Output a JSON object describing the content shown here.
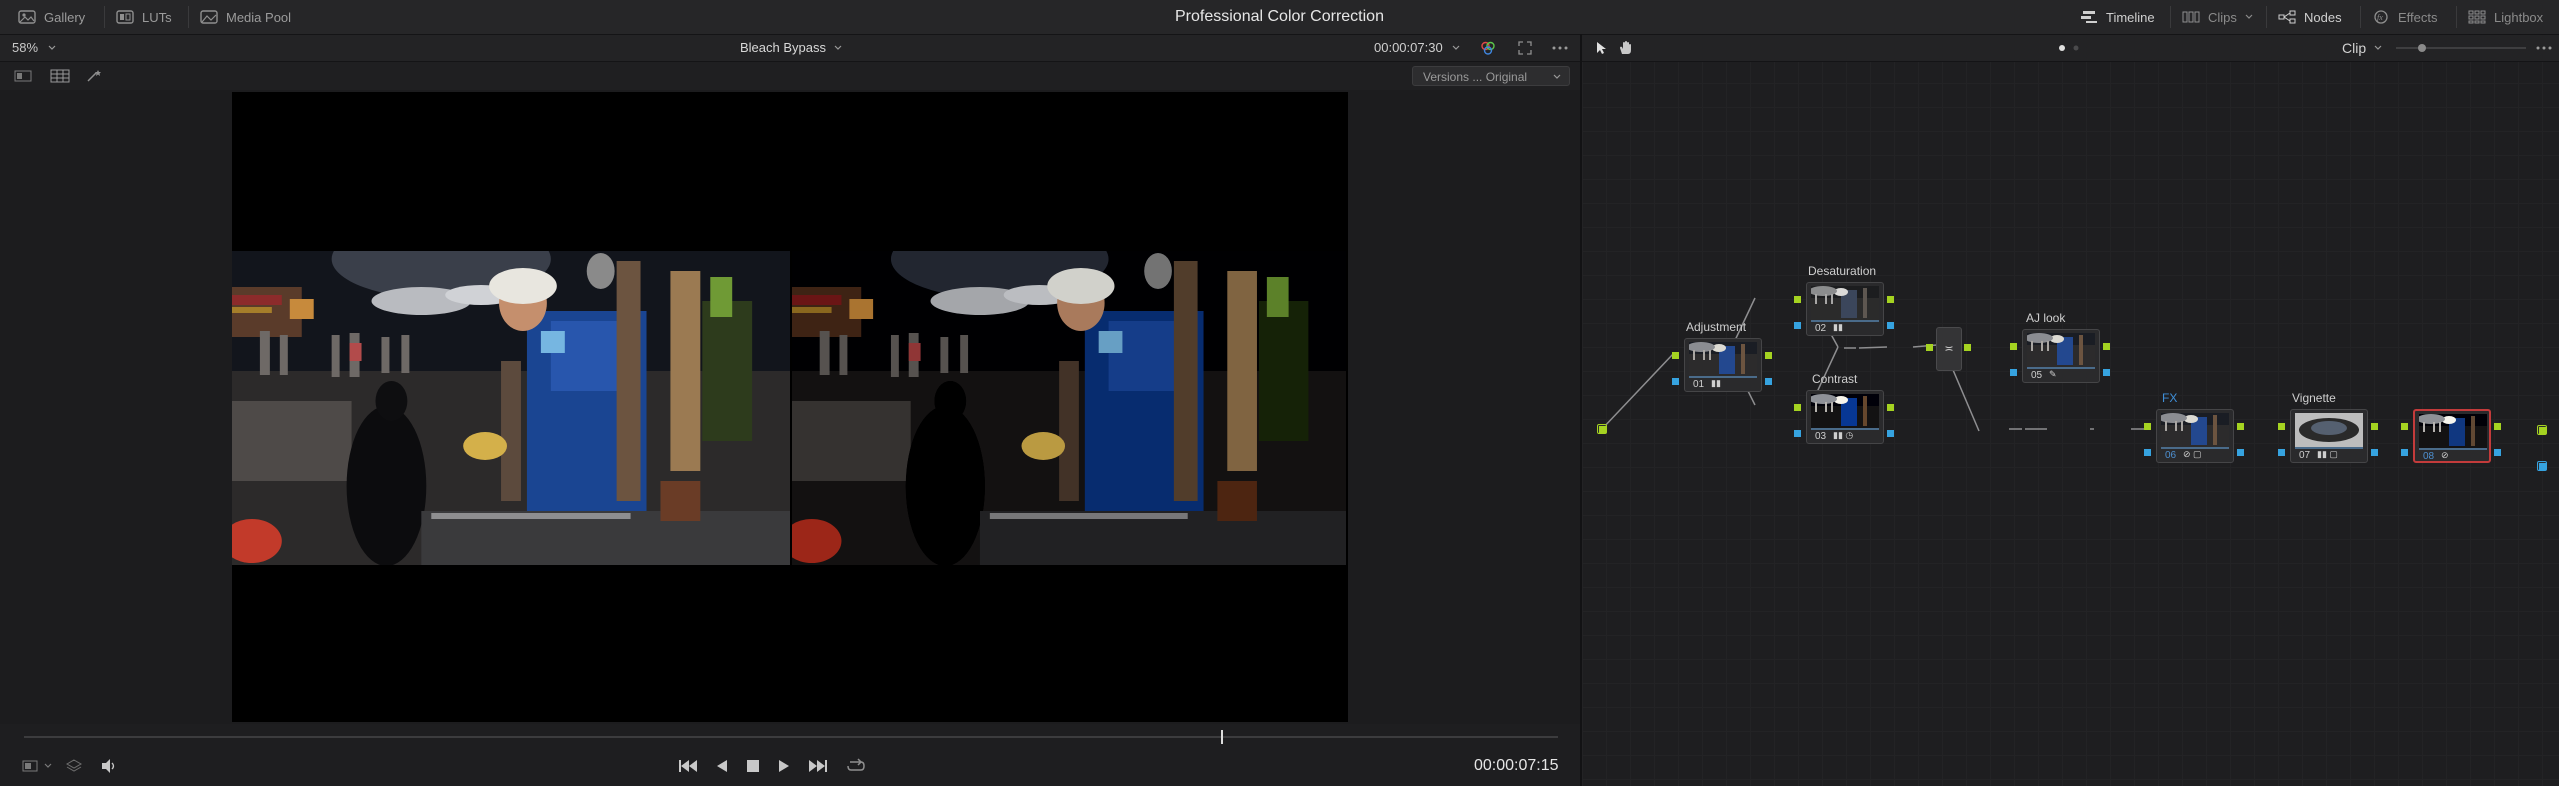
{
  "app": {
    "title": "Professional Color Correction"
  },
  "topbar": {
    "left": [
      {
        "label": "Gallery",
        "icon": "gallery-icon"
      },
      {
        "label": "LUTs",
        "icon": "luts-icon"
      },
      {
        "label": "Media Pool",
        "icon": "media-pool-icon"
      }
    ],
    "right": [
      {
        "label": "Timeline",
        "icon": "timeline-icon"
      },
      {
        "label": "Clips",
        "icon": "clips-icon"
      },
      {
        "label": "Nodes",
        "icon": "nodes-icon"
      },
      {
        "label": "Effects",
        "icon": "effects-icon"
      },
      {
        "label": "Lightbox",
        "icon": "lightbox-icon"
      }
    ]
  },
  "viewer": {
    "zoom": "58%",
    "clip_name": "Bleach Bypass",
    "timecode": "00:00:07:30",
    "versions": "Versions ... Original",
    "transport_timecode": "00:00:07:15",
    "playhead_fraction": 0.78
  },
  "node_editor": {
    "mode": "Clip",
    "nodes": [
      {
        "id": "01",
        "label": "Adjustment"
      },
      {
        "id": "02",
        "label": "Desaturation"
      },
      {
        "id": "03",
        "label": "Contrast"
      },
      {
        "id": "05",
        "label": "AJ look"
      },
      {
        "id": "06",
        "label": "FX"
      },
      {
        "id": "07",
        "label": "Vignette"
      },
      {
        "id": "08",
        "label": ""
      }
    ],
    "mixer_symbol": "≍"
  },
  "colors": {
    "accent_green": "#a5d321",
    "accent_blue": "#36a3e0",
    "selected_node": "#c33b3b"
  }
}
